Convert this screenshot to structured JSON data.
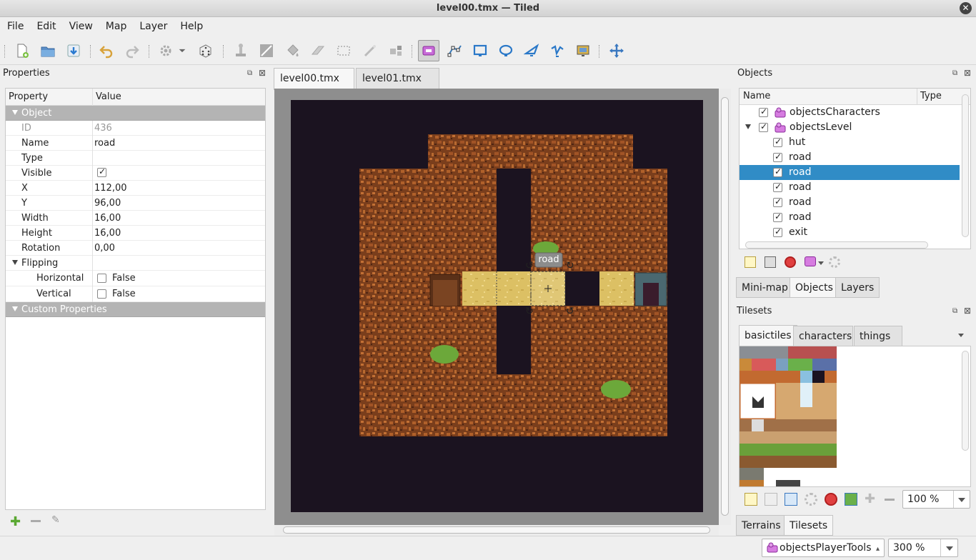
{
  "window": {
    "title": "level00.tmx — Tiled",
    "close_glyph": "✕"
  },
  "menu": [
    "File",
    "Edit",
    "View",
    "Map",
    "Layer",
    "Help"
  ],
  "toolbar": {
    "icons": [
      "new-map-icon",
      "open-icon",
      "save-icon",
      "undo-icon",
      "redo-icon",
      "command-gear-icon",
      "dropdown-icon",
      "random-dice-icon",
      "stamp-brush-icon",
      "terrain-brush-icon",
      "bucket-fill-icon",
      "eraser-icon",
      "rect-select-icon",
      "magic-wand-icon",
      "select-same-tile-icon",
      "select-objects-icon",
      "edit-polygons-icon",
      "insert-rectangle-icon",
      "insert-ellipse-icon",
      "insert-polygon-icon",
      "insert-polyline-icon",
      "insert-tile-icon",
      "move-icon"
    ]
  },
  "properties": {
    "title": "Properties",
    "col_property": "Property",
    "col_value": "Value",
    "group_object": "Object",
    "rows": {
      "id_k": "ID",
      "id_v": "436",
      "name_k": "Name",
      "name_v": "road",
      "type_k": "Type",
      "type_v": "",
      "visible_k": "Visible",
      "x_k": "X",
      "x_v": "112,00",
      "y_k": "Y",
      "y_v": "96,00",
      "width_k": "Width",
      "width_v": "16,00",
      "height_k": "Height",
      "height_v": "16,00",
      "rotation_k": "Rotation",
      "rotation_v": "0,00",
      "flipping_k": "Flipping",
      "horizontal_k": "Horizontal",
      "horizontal_v": "False",
      "vertical_k": "Vertical",
      "vertical_v": "False"
    },
    "group_custom": "Custom Properties"
  },
  "tabs": [
    {
      "label": "level00.tmx",
      "active": true
    },
    {
      "label": "level01.tmx",
      "active": false
    }
  ],
  "map": {
    "selected_label": "road"
  },
  "objects_panel": {
    "title": "Objects",
    "col_name": "Name",
    "col_type": "Type",
    "items": [
      {
        "label": "objectsCharacters",
        "layer": true
      },
      {
        "label": "objectsLevel",
        "layer": true
      },
      {
        "label": "hut"
      },
      {
        "label": "road"
      },
      {
        "label": "road",
        "selected": true
      },
      {
        "label": "road"
      },
      {
        "label": "road"
      },
      {
        "label": "road"
      },
      {
        "label": "exit"
      }
    ],
    "bottom_tabs": [
      "Mini-map",
      "Objects",
      "Layers"
    ],
    "active_bottom_tab": "Objects"
  },
  "tilesets_panel": {
    "title": "Tilesets",
    "tabs": [
      "basictiles",
      "characters",
      "things"
    ],
    "active_tab": "basictiles",
    "zoom": "100 %",
    "bottom_tabs": [
      "Terrains",
      "Tilesets"
    ],
    "active_bottom_tab": "Tilesets"
  },
  "status": {
    "tool_layer": "objectsPlayerTools",
    "map_zoom": "300 %"
  },
  "colors": {
    "selection": "#308cc6",
    "map_bg": "#1a1220",
    "rock": "#8a4a22",
    "road": "#e0c466"
  }
}
